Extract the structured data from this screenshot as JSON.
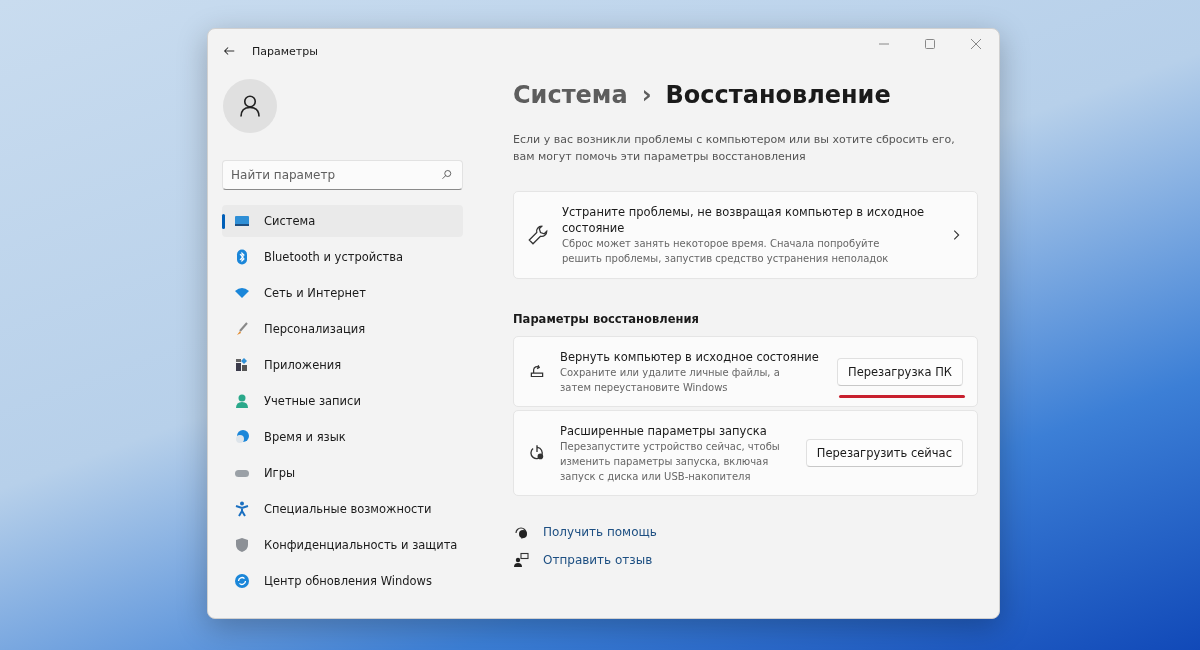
{
  "window": {
    "title": "Параметры"
  },
  "search": {
    "placeholder": "Найти параметр"
  },
  "sidebar": {
    "items": [
      {
        "label": "Система",
        "kind": "system",
        "selected": true
      },
      {
        "label": "Bluetooth и устройства",
        "kind": "bluetooth",
        "selected": false
      },
      {
        "label": "Сеть и Интернет",
        "kind": "network",
        "selected": false
      },
      {
        "label": "Персонализация",
        "kind": "brush",
        "selected": false
      },
      {
        "label": "Приложения",
        "kind": "apps",
        "selected": false
      },
      {
        "label": "Учетные записи",
        "kind": "person",
        "selected": false
      },
      {
        "label": "Время и язык",
        "kind": "globe",
        "selected": false
      },
      {
        "label": "Игры",
        "kind": "gamepad",
        "selected": false
      },
      {
        "label": "Специальные возможности",
        "kind": "accessibility",
        "selected": false
      },
      {
        "label": "Конфиденциальность и защита",
        "kind": "shield",
        "selected": false
      },
      {
        "label": "Центр обновления Windows",
        "kind": "update",
        "selected": false
      }
    ]
  },
  "breadcrumb": {
    "parent": "Система",
    "separator": "›",
    "current": "Восстановление"
  },
  "intro": "Если у вас возникли проблемы с компьютером или вы хотите сбросить его, вам могут помочь эти параметры восстановления",
  "troubleshoot_card": {
    "title": "Устраните проблемы, не возвращая компьютер в исходное состояние",
    "description": "Сброс может занять некоторое время. Сначала попробуйте решить проблемы, запустив средство устранения неполадок"
  },
  "section_title": "Параметры восстановления",
  "options": [
    {
      "kind": "reset",
      "title": "Вернуть компьютер в исходное состояние",
      "description": "Сохраните или удалите личные файлы, а затем переустановите Windows",
      "button": "Перезагрузка ПК",
      "highlighted": true
    },
    {
      "kind": "startup",
      "title": "Расширенные параметры запуска",
      "description": "Перезапустите устройство сейчас, чтобы изменить параметры запуска, включая запуск с диска или USB-накопителя",
      "button": "Перезагрузить сейчас",
      "highlighted": false
    }
  ],
  "links": [
    {
      "kind": "help",
      "label": "Получить помощь"
    },
    {
      "kind": "feedback",
      "label": "Отправить отзыв"
    }
  ]
}
